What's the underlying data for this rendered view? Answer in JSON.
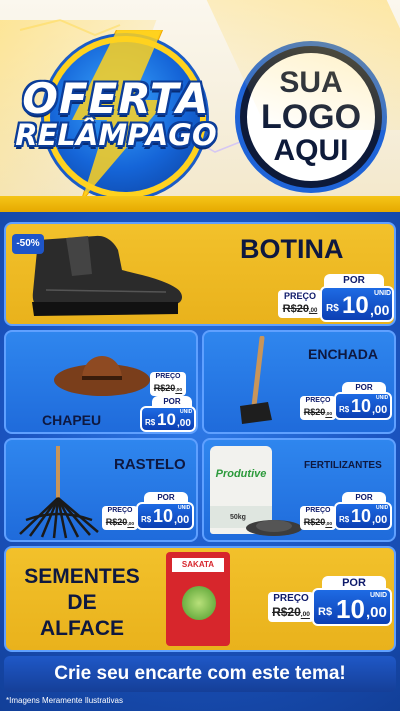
{
  "header": {
    "offer_title": "OFERTA",
    "offer_subtitle": "RELÂMPAGO",
    "logo_line1": "SUA",
    "logo_line2": "LOGO",
    "logo_line3": "AQUI"
  },
  "products": {
    "botina": {
      "name": "BOTINA",
      "badge": "-50%",
      "por": "POR",
      "preco": "PREÇO",
      "old_int": "R$20",
      "old_dec": ",00",
      "cur": "R$",
      "price_int": "10",
      "price_dec": ",00",
      "unid": "UNID"
    },
    "chapeu": {
      "name": "CHAPEU",
      "por": "POR",
      "preco": "PREÇO",
      "old_int": "R$20",
      "old_dec": ",00",
      "cur": "R$",
      "price_int": "10",
      "price_dec": ",00",
      "unid": "UNID"
    },
    "enchada": {
      "name": "ENCHADA",
      "por": "POR",
      "preco": "PREÇO",
      "old_int": "R$20",
      "old_dec": ",00",
      "cur": "R$",
      "price_int": "10",
      "price_dec": ",00",
      "unid": "UNID"
    },
    "rastelo": {
      "name": "RASTELO",
      "por": "POR",
      "preco": "PREÇO",
      "old_int": "R$20",
      "old_dec": ",00",
      "cur": "R$",
      "price_int": "10",
      "price_dec": ",00",
      "unid": "UNID"
    },
    "fertilizantes": {
      "name": "FERTILIZANTES",
      "bag_brand": "Produtive",
      "bag_weight": "50kg",
      "por": "POR",
      "preco": "PREÇO",
      "old_int": "R$20",
      "old_dec": ",00",
      "cur": "R$",
      "price_int": "10",
      "price_dec": ",00",
      "unid": "UNID"
    },
    "sementes": {
      "name_line1": "SEMENTES",
      "name_line2": "DE",
      "name_line3": "ALFACE",
      "pack_brand": "SAKATA",
      "por": "POR",
      "preco": "PREÇO",
      "old_int": "R$20",
      "old_dec": ",00",
      "cur": "R$",
      "price_int": "10",
      "price_dec": ",00",
      "unid": "UNID"
    }
  },
  "footer": {
    "banner": "Crie seu encarte com este tema!",
    "disclaimer": "*Imagens Meramente Ilustrativas"
  },
  "colors": {
    "accent_yellow": "#f2c12b",
    "brand_blue": "#1f6bdb",
    "dark_text": "#0e1840"
  }
}
